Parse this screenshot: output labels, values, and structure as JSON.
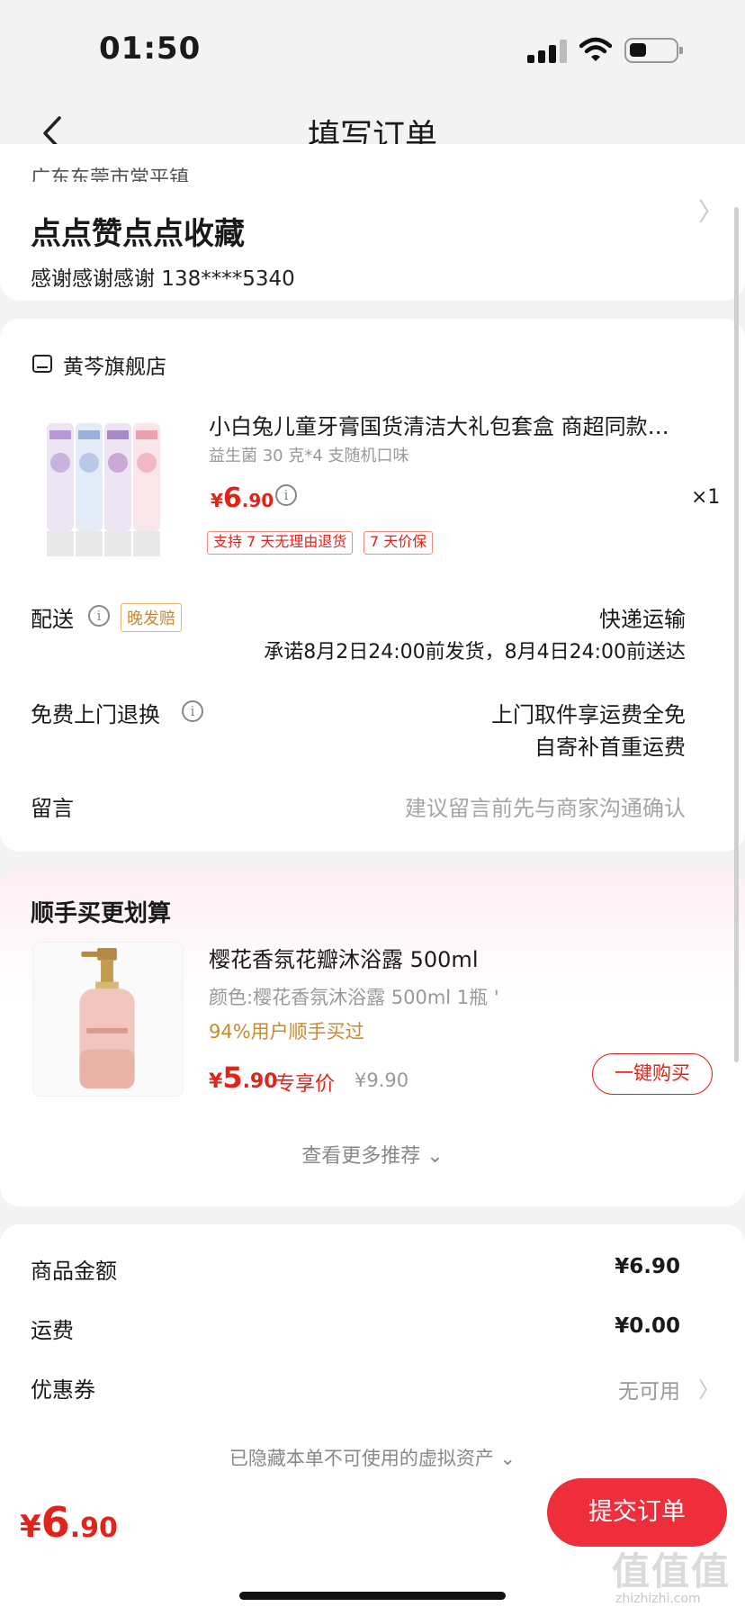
{
  "status_bar": {
    "time": "01:50"
  },
  "nav": {
    "title": "填写订单"
  },
  "address": {
    "region": "广东东莞市常平镇",
    "name": "点点赞点点收藏",
    "contact": "感谢感谢感谢  138****5340"
  },
  "store": {
    "name": "黄芩旗舰店",
    "product": {
      "title": "小白兔儿童牙膏国货清洁大礼包套盒 商超同款…",
      "spec": "益生菌 30 克*4 支随机口味",
      "price_currency": "¥",
      "price_int": "6",
      "price_dec": ".90",
      "qty": "×1",
      "tags": [
        "支持 7 天无理由退货",
        "7 天价保"
      ]
    },
    "delivery": {
      "label": "配送",
      "badge": "晚发赔",
      "method": "快递运输",
      "promise": "承诺8月2日24:00前发货，8月4日24:00前送达"
    },
    "return": {
      "label": "免费上门退换",
      "line1": "上门取件享运费全免",
      "line2": "自寄补首重运费"
    },
    "message": {
      "label": "留言",
      "placeholder": "建议留言前先与商家沟通确认"
    }
  },
  "upsell": {
    "title": "顺手买更划算",
    "name": "樱花香氛花瓣沐浴露 500ml",
    "spec": "颜色:樱花香氛沐浴露 500ml 1瓶 '",
    "stat": "94%用户顺手买过",
    "price_currency": "¥",
    "price_int": "5",
    "price_dec": ".90",
    "exclusive": "专享价",
    "original": "¥9.90",
    "buy_label": "一键购买",
    "see_more": "查看更多推荐"
  },
  "summary": {
    "items": [
      {
        "label": "商品金额",
        "value": "¥6.90"
      },
      {
        "label": "运费",
        "value": "¥0.00"
      },
      {
        "label": "优惠券",
        "value": "无可用"
      }
    ],
    "hidden_assets": "已隐藏本单不可使用的虚拟资产"
  },
  "bottom": {
    "total_currency": "¥",
    "total_int": "6",
    "total_dec": ".90",
    "submit": "提交订单"
  },
  "watermark": {
    "main": "值值值",
    "sub": "zhizhizhi.com"
  },
  "colors": {
    "accent": "#e2231a",
    "button": "#ee2e3a",
    "badge": "#c98a2b"
  },
  "icons": [
    "back-icon",
    "signal-icon",
    "wifi-icon",
    "battery-icon",
    "store-icon",
    "info-icon",
    "chevron-right-icon",
    "chevron-down-icon"
  ]
}
